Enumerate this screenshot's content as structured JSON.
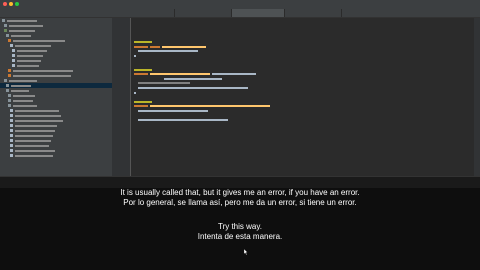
{
  "colors": {
    "ide_background": "#2b2b2b",
    "panel_background": "#3c3f41",
    "selection": "#0d293e",
    "keyword": "#cc7832",
    "annotation": "#bbb529",
    "method": "#ffc66d",
    "comment": "#808080",
    "string": "#6a8759",
    "subtitle_text": "#ffffff",
    "video_background": "#0e0e0e"
  },
  "window": {
    "traffic_lights": [
      "#ff5f57",
      "#febc2e",
      "#28c840"
    ]
  },
  "subtitles": [
    {
      "english": "It is usually called that, but it gives me an error, if you have an error.",
      "spanish": "Por lo general, se llama así, pero me da un error, si tiene un error."
    },
    {
      "english": "Try this way.",
      "spanish": "Intenta de esta manera."
    }
  ]
}
